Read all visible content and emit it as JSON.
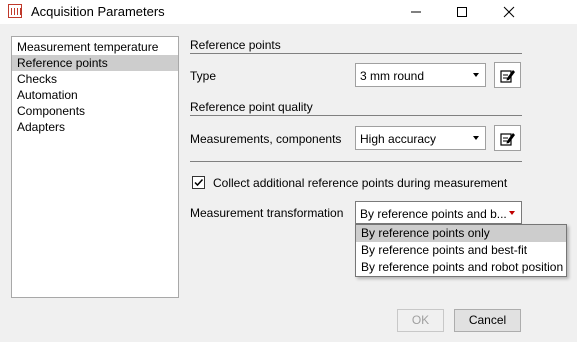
{
  "window": {
    "title": "Acquisition Parameters",
    "app_icon": "app-logo-icon",
    "controls": [
      "minimize-icon",
      "maximize-icon",
      "close-icon"
    ]
  },
  "sidebar": {
    "items": [
      {
        "label": "Measurement temperature",
        "selected": false
      },
      {
        "label": "Reference points",
        "selected": true
      },
      {
        "label": "Checks",
        "selected": false
      },
      {
        "label": "Automation",
        "selected": false
      },
      {
        "label": "Components",
        "selected": false
      },
      {
        "label": "Adapters",
        "selected": false
      }
    ]
  },
  "reference_points": {
    "section_title": "Reference points",
    "type_label": "Type",
    "type_value": "3 mm round",
    "edit_icon": "edit-icon"
  },
  "quality": {
    "section_title": "Reference point quality",
    "measurements_label": "Measurements, components",
    "measurements_value": "High accuracy",
    "edit_icon": "edit-icon"
  },
  "collect": {
    "label": "Collect additional reference points during measurement",
    "checked": true
  },
  "transformation": {
    "label": "Measurement transformation",
    "value": "By reference points and b...",
    "options": [
      {
        "label": "By reference points only",
        "highlighted": true
      },
      {
        "label": "By reference points and best-fit",
        "highlighted": false
      },
      {
        "label": "By reference points and robot position",
        "highlighted": false
      }
    ]
  },
  "footer": {
    "ok_label": "OK",
    "ok_enabled": false,
    "cancel_label": "Cancel"
  },
  "colors": {
    "dialog_bg": "#f0f0f0",
    "selection_bg": "#cdcdcd",
    "icon_red": "#c0392b",
    "dropdown_arrow_active": "#c00000"
  }
}
